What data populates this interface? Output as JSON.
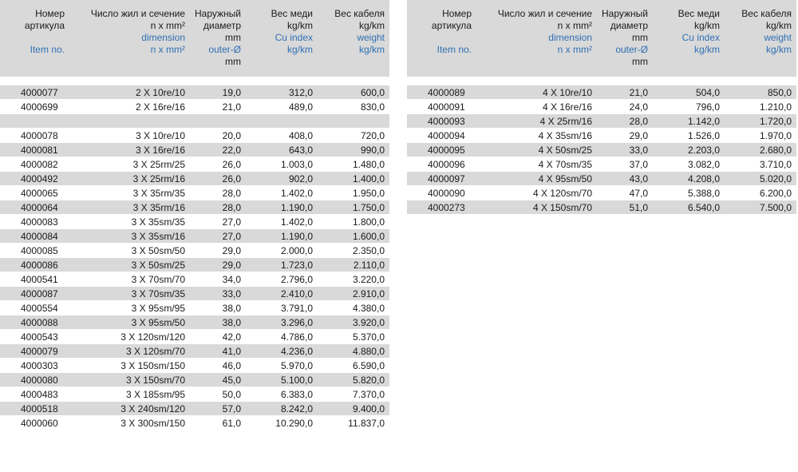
{
  "headers": {
    "item": {
      "ru": "Номер артикула",
      "en": "Item no."
    },
    "section": {
      "ru": "Число жил и сечение",
      "unit": "n x mm²",
      "en1": "dimension",
      "en2": "n x mm²"
    },
    "outer": {
      "ru": "Наружный диаметр",
      "unit": "mm",
      "en": "outer-Ø",
      "en_unit": "mm"
    },
    "cu": {
      "ru": "Вес меди",
      "unit": "kg/km",
      "en": "Cu index",
      "en_unit": "kg/km"
    },
    "weight": {
      "ru": "Вес кабеля",
      "unit": "kg/km",
      "en": "weight",
      "en_unit": "kg/km"
    }
  },
  "left_rows": [
    {
      "shade": true,
      "item": "4000077",
      "section": "2 X 10re/10",
      "outer": "19,0",
      "cu": "312,0",
      "weight": "600,0"
    },
    {
      "shade": false,
      "item": "4000699",
      "section": "2 X 16re/16",
      "outer": "21,0",
      "cu": "489,0",
      "weight": "830,0"
    },
    {
      "shade": true,
      "item": "",
      "section": "",
      "outer": "",
      "cu": "",
      "weight": ""
    },
    {
      "shade": false,
      "item": "4000078",
      "section": "3 X 10re/10",
      "outer": "20,0",
      "cu": "408,0",
      "weight": "720,0"
    },
    {
      "shade": true,
      "item": "4000081",
      "section": "3 X 16re/16",
      "outer": "22,0",
      "cu": "643,0",
      "weight": "990,0"
    },
    {
      "shade": false,
      "item": "4000082",
      "section": "3 X 25rm/25",
      "outer": "26,0",
      "cu": "1.003,0",
      "weight": "1.480,0"
    },
    {
      "shade": true,
      "item": "4000492",
      "section": "3 X 25rm/16",
      "outer": "26,0",
      "cu": "902,0",
      "weight": "1.400,0"
    },
    {
      "shade": false,
      "item": "4000065",
      "section": "3 X 35rm/35",
      "outer": "28,0",
      "cu": "1.402,0",
      "weight": "1.950,0"
    },
    {
      "shade": true,
      "item": "4000064",
      "section": "3 X 35rm/16",
      "outer": "28,0",
      "cu": "1.190,0",
      "weight": "1.750,0"
    },
    {
      "shade": false,
      "item": "4000083",
      "section": "3 X 35sm/35",
      "outer": "27,0",
      "cu": "1.402,0",
      "weight": "1.800,0"
    },
    {
      "shade": true,
      "item": "4000084",
      "section": "3 X 35sm/16",
      "outer": "27,0",
      "cu": "1.190,0",
      "weight": "1.600,0"
    },
    {
      "shade": false,
      "item": "4000085",
      "section": "3 X 50sm/50",
      "outer": "29,0",
      "cu": "2.000,0",
      "weight": "2.350,0"
    },
    {
      "shade": true,
      "item": "4000086",
      "section": "3 X 50sm/25",
      "outer": "29,0",
      "cu": "1.723,0",
      "weight": "2.110,0"
    },
    {
      "shade": false,
      "item": "4000541",
      "section": "3 X 70sm/70",
      "outer": "34,0",
      "cu": "2.796,0",
      "weight": "3.220,0"
    },
    {
      "shade": true,
      "item": "4000087",
      "section": "3 X 70sm/35",
      "outer": "33,0",
      "cu": "2.410,0",
      "weight": "2.910,0"
    },
    {
      "shade": false,
      "item": "4000554",
      "section": "3 X 95sm/95",
      "outer": "38,0",
      "cu": "3.791,0",
      "weight": "4.380,0"
    },
    {
      "shade": true,
      "item": "4000088",
      "section": "3 X 95sm/50",
      "outer": "38,0",
      "cu": "3.296,0",
      "weight": "3.920,0"
    },
    {
      "shade": false,
      "item": "4000543",
      "section": "3 X 120sm/120",
      "outer": "42,0",
      "cu": "4.786,0",
      "weight": "5.370,0"
    },
    {
      "shade": true,
      "item": "4000079",
      "section": "3 X 120sm/70",
      "outer": "41,0",
      "cu": "4.236,0",
      "weight": "4.880,0"
    },
    {
      "shade": false,
      "item": "4000303",
      "section": "3 X 150sm/150",
      "outer": "46,0",
      "cu": "5.970,0",
      "weight": "6.590,0"
    },
    {
      "shade": true,
      "item": "4000080",
      "section": "3 X 150sm/70",
      "outer": "45,0",
      "cu": "5.100,0",
      "weight": "5.820,0"
    },
    {
      "shade": false,
      "item": "4000483",
      "section": "3 X 185sm/95",
      "outer": "50,0",
      "cu": "6.383,0",
      "weight": "7.370,0"
    },
    {
      "shade": true,
      "item": "4000518",
      "section": "3 X 240sm/120",
      "outer": "57,0",
      "cu": "8.242,0",
      "weight": "9.400,0"
    },
    {
      "shade": false,
      "item": "4000060",
      "section": "3 X 300sm/150",
      "outer": "61,0",
      "cu": "10.290,0",
      "weight": "11.837,0"
    }
  ],
  "right_rows": [
    {
      "shade": true,
      "item": "4000089",
      "section": "4 X 10re/10",
      "outer": "21,0",
      "cu": "504,0",
      "weight": "850,0"
    },
    {
      "shade": false,
      "item": "4000091",
      "section": "4 X 16re/16",
      "outer": "24,0",
      "cu": "796,0",
      "weight": "1.210,0"
    },
    {
      "shade": true,
      "item": "4000093",
      "section": "4 X 25rm/16",
      "outer": "28,0",
      "cu": "1.142,0",
      "weight": "1.720,0"
    },
    {
      "shade": false,
      "item": "4000094",
      "section": "4 X 35sm/16",
      "outer": "29,0",
      "cu": "1.526,0",
      "weight": "1.970,0"
    },
    {
      "shade": true,
      "item": "4000095",
      "section": "4 X 50sm/25",
      "outer": "33,0",
      "cu": "2.203,0",
      "weight": "2.680,0"
    },
    {
      "shade": false,
      "item": "4000096",
      "section": "4 X 70sm/35",
      "outer": "37,0",
      "cu": "3.082,0",
      "weight": "3.710,0"
    },
    {
      "shade": true,
      "item": "4000097",
      "section": "4 X 95sm/50",
      "outer": "43,0",
      "cu": "4.208,0",
      "weight": "5.020,0"
    },
    {
      "shade": false,
      "item": "4000090",
      "section": "4 X 120sm/70",
      "outer": "47,0",
      "cu": "5.388,0",
      "weight": "6.200,0"
    },
    {
      "shade": true,
      "item": "4000273",
      "section": "4 X 150sm/70",
      "outer": "51,0",
      "cu": "6.540,0",
      "weight": "7.500,0"
    }
  ]
}
